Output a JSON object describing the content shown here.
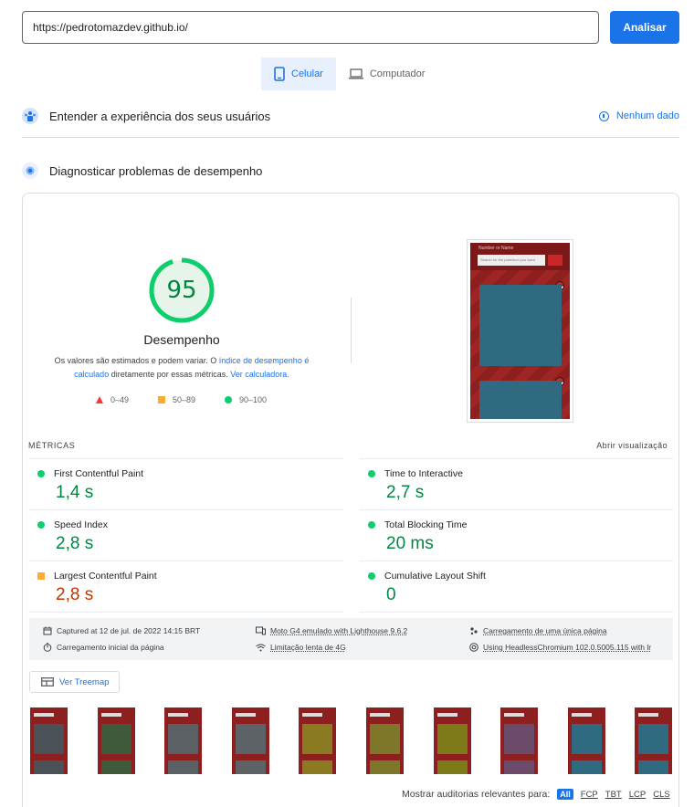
{
  "url_input": {
    "value": "https://pedrotomazdev.github.io/"
  },
  "analyze_button": "Analisar",
  "device_tabs": [
    {
      "label": "Celular",
      "active": true,
      "icon": "phone-icon"
    },
    {
      "label": "Computador",
      "active": false,
      "icon": "laptop-icon"
    }
  ],
  "field_data": {
    "title": "Entender a experiência dos seus usuários",
    "no_data": "Nenhum dado"
  },
  "lab_data": {
    "title": "Diagnosticar problemas de desempenho"
  },
  "score": {
    "value": 95,
    "label": "Desempenho",
    "desc_pre": "Os valores são estimados e podem variar. O ",
    "desc_link": "índice de desempenho é calculado",
    "desc_mid": " diretamente por essas métricas. ",
    "desc_link2": "Ver calculadora.",
    "legend": [
      {
        "range": "0–49",
        "shape": "triangle",
        "color": "#ff3333"
      },
      {
        "range": "50–89",
        "shape": "square",
        "color": "#ffaa33"
      },
      {
        "range": "90–100",
        "shape": "circle",
        "color": "#0cce6b"
      }
    ]
  },
  "screenshot": {
    "label": "Number or Name",
    "search_placeholder": "Search for the pokemon you want"
  },
  "metrics": {
    "title": "MÉTRICAS",
    "expand": "Abrir visualização",
    "items": [
      {
        "name": "First Contentful Paint",
        "value": "1,4 s",
        "status": "good"
      },
      {
        "name": "Time to Interactive",
        "value": "2,7 s",
        "status": "good"
      },
      {
        "name": "Speed Index",
        "value": "2,8 s",
        "status": "good"
      },
      {
        "name": "Total Blocking Time",
        "value": "20 ms",
        "status": "good"
      },
      {
        "name": "Largest Contentful Paint",
        "value": "2,8 s",
        "status": "average"
      },
      {
        "name": "Cumulative Layout Shift",
        "value": "0",
        "status": "good"
      }
    ]
  },
  "env": {
    "captured": "Captured at 12 de jul. de 2022 14:15 BRT",
    "device": "Moto G4 emulado with Lighthouse 9.6.2",
    "session": "Carregamento de uma única página",
    "initial_load": "Carregamento inicial da página",
    "throttling": "Limitação lenta de 4G",
    "browser": "Using HeadlessChromium 102.0.5005.115 with lr"
  },
  "treemap_button": "Ver Treemap",
  "filmstrip_colors": [
    "#4a5258",
    "#3e5a3a",
    "#5a6064",
    "#5c6266",
    "#8a7a22",
    "#7e7628",
    "#7e7a1a",
    "#6b4a6a",
    "#2f6a80",
    "#2f6a80"
  ],
  "audit_filter": {
    "label": "Mostrar auditorias relevantes para:",
    "chips": [
      "All",
      "FCP",
      "TBT",
      "LCP",
      "CLS"
    ]
  }
}
